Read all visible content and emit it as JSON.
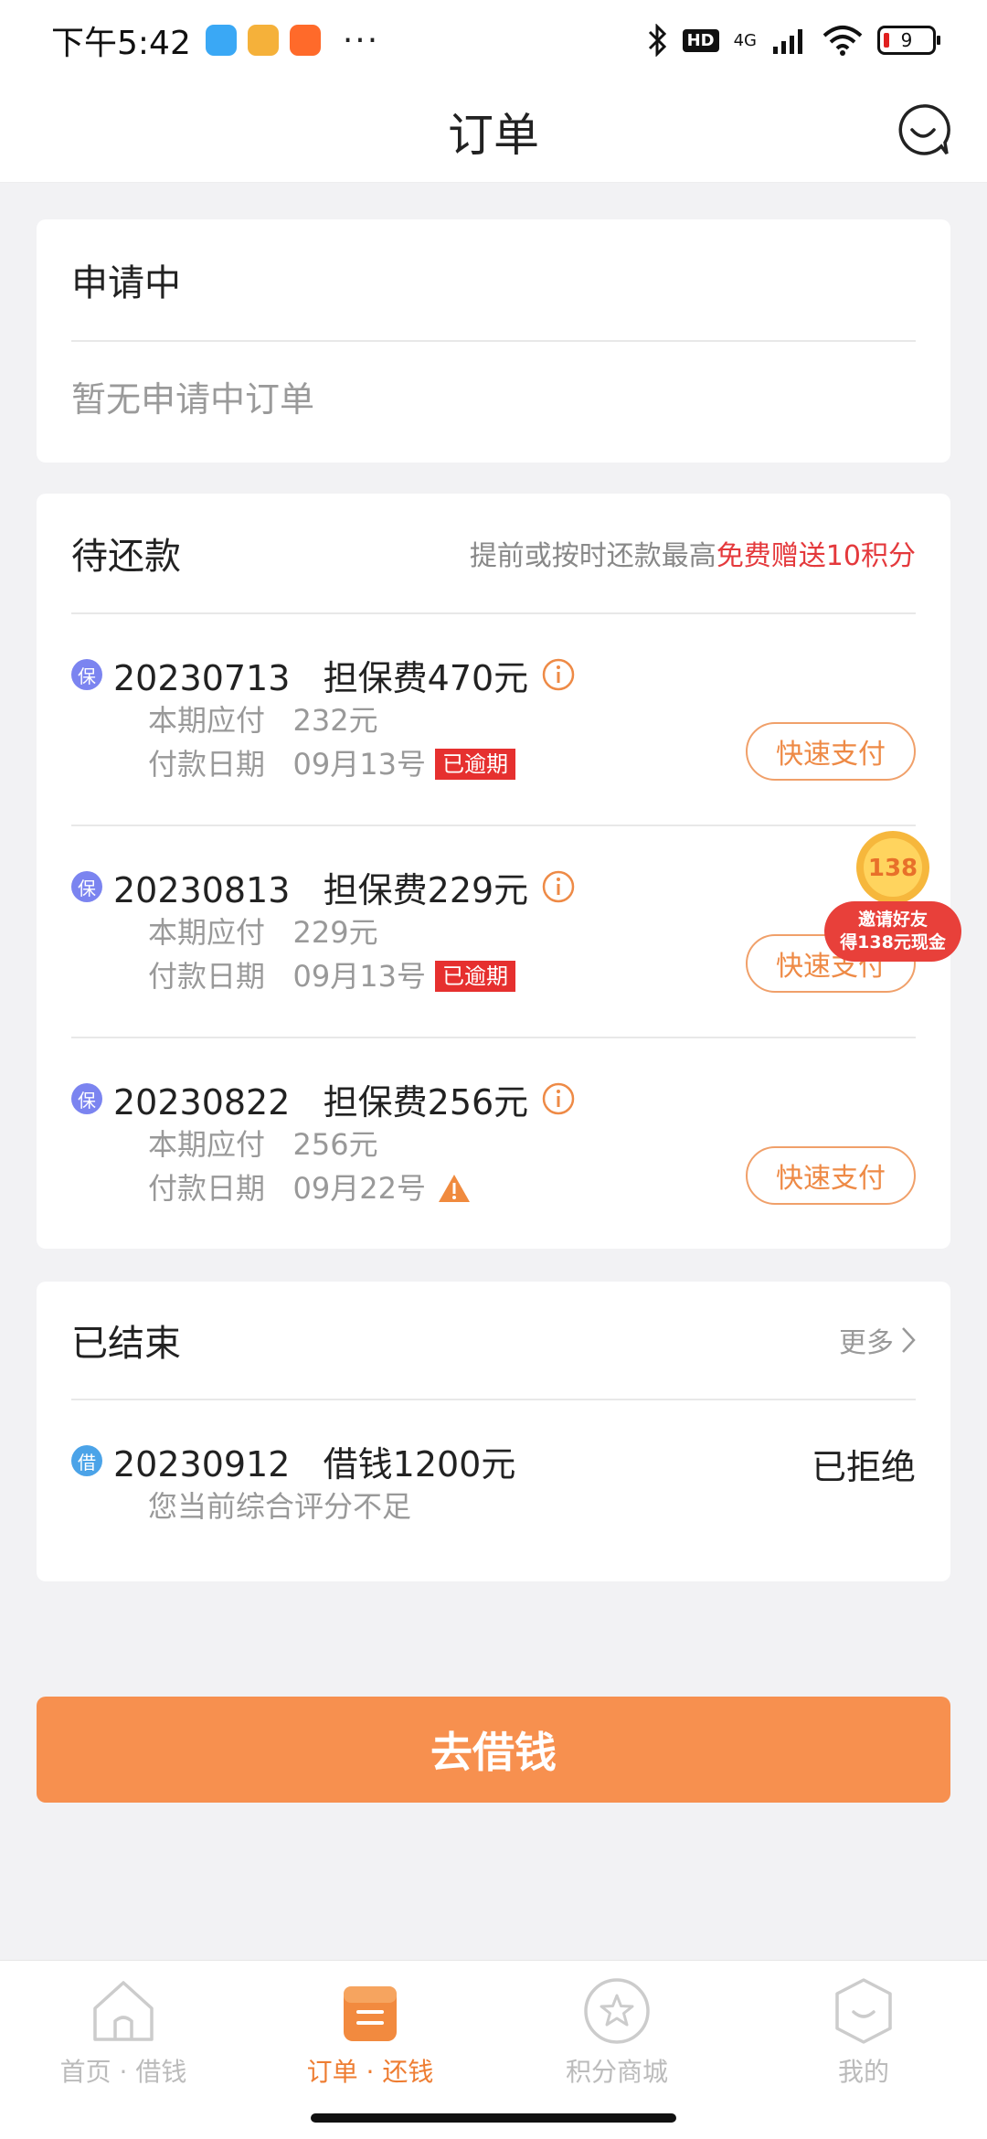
{
  "status_bar": {
    "time": "下午5:42",
    "dots": "···",
    "network": "4G",
    "hd_label": "HD",
    "battery": "9"
  },
  "nav": {
    "title": "订单"
  },
  "applying": {
    "title": "申请中",
    "empty_text": "暂无申请中订单"
  },
  "pending": {
    "title": "待还款",
    "note_prefix": "提前或按时还款最高",
    "note_highlight": "免费赠送10积分",
    "orders": [
      {
        "tag": "保",
        "title": "20230713   担保费470元",
        "due_label": "本期应付   232元",
        "date_label": "付款日期   09月13号",
        "badge": "已逾期",
        "button": "快速支付"
      },
      {
        "tag": "保",
        "title": "20230813   担保费229元",
        "due_label": "本期应付   229元",
        "date_label": "付款日期   09月13号",
        "badge": "已逾期",
        "button": "快速支付"
      },
      {
        "tag": "保",
        "title": "20230822   担保费256元",
        "due_label": "本期应付   256元",
        "date_label": "付款日期   09月22号",
        "badge": "",
        "button": "快速支付"
      }
    ]
  },
  "finished": {
    "title": "已结束",
    "more": "更多",
    "orders": [
      {
        "tag": "借",
        "title": "20230912   借钱1200元",
        "status": "已拒绝",
        "reason": "您当前综合评分不足"
      }
    ]
  },
  "promo": {
    "coin": "138",
    "line1": "邀请好友",
    "line2": "得138元现金"
  },
  "cta": {
    "label": "去借钱"
  },
  "tabs": [
    {
      "label": "首页 · 借钱",
      "icon": "home-icon"
    },
    {
      "label": "订单 · 还钱",
      "icon": "order-icon"
    },
    {
      "label": "积分商城",
      "icon": "star-icon"
    },
    {
      "label": "我的",
      "icon": "profile-icon"
    }
  ],
  "colors": {
    "accent": "#f7904f",
    "alert": "#e6302f",
    "highlight": "#e4393c"
  }
}
